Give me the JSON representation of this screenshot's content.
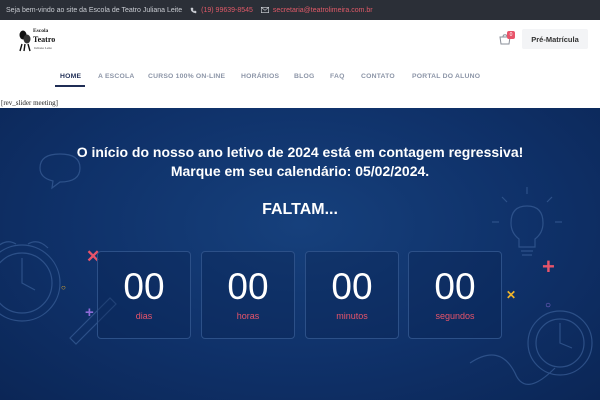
{
  "topbar": {
    "welcome": "Seja bem-vindo ao site da Escola de Teatro Juliana Leite",
    "phone": "(19) 99639-8545",
    "email": "secretaria@teatrolimeira.com.br",
    "phone_icon": "phone-icon",
    "email_icon": "envelope-icon"
  },
  "logo": {
    "line1": "Escola",
    "line2": "Teatro",
    "line3": "Juliana Leite"
  },
  "header": {
    "cart_count": "0",
    "cart_icon": "cart-icon",
    "cta_label": "Pré-Matrícula"
  },
  "nav": {
    "items": [
      {
        "label": "HOME",
        "active": true
      },
      {
        "label": "A ESCOLA"
      },
      {
        "label": "CURSO 100% ON-LINE"
      },
      {
        "label": "HORÁRIOS"
      },
      {
        "label": "BLOG"
      },
      {
        "label": "FAQ"
      },
      {
        "label": "CONTATO"
      },
      {
        "label": "PORTAL DO ALUNO"
      }
    ]
  },
  "shortcode": "[rev_slider meeting]",
  "hero": {
    "headline": "O início do nosso ano letivo de 2024 está em contagem regressiva! Marque em seu calendário: 05/02/2024.",
    "faltam": "FALTAM...",
    "countdown": [
      {
        "value": "00",
        "label": "dias"
      },
      {
        "value": "00",
        "label": "horas"
      },
      {
        "value": "00",
        "label": "minutos"
      },
      {
        "value": "00",
        "label": "segundos"
      }
    ]
  },
  "colors": {
    "topbar_bg": "#2b2f37",
    "accent_red": "#e8546a",
    "hero_bg": "#0f3169",
    "nav_active": "#1f2d55"
  }
}
